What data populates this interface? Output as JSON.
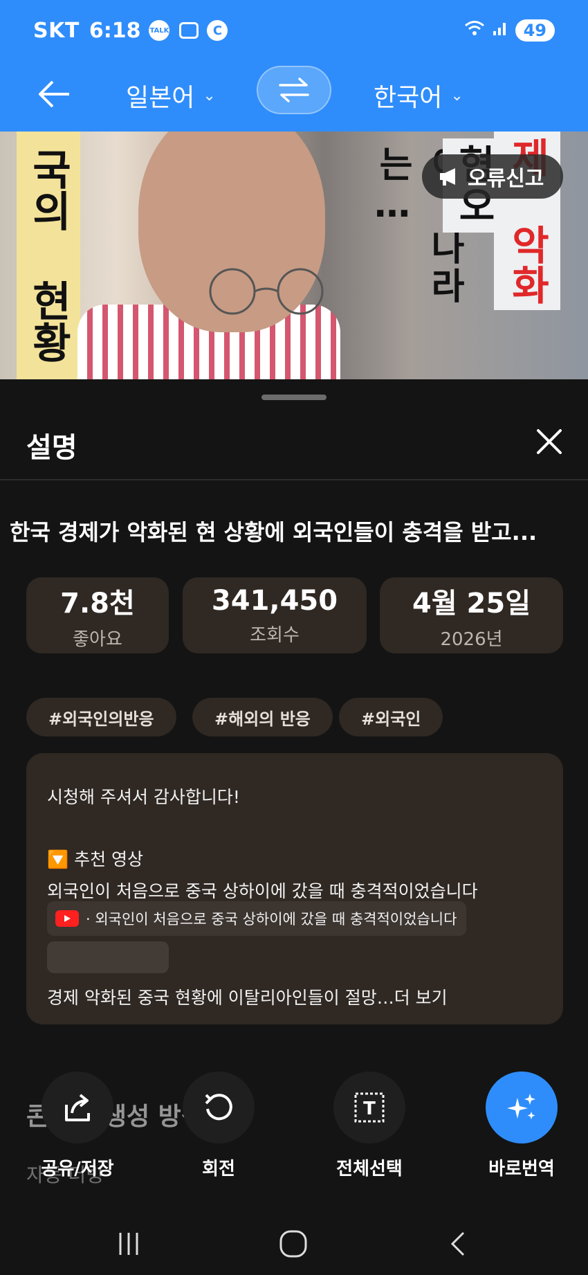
{
  "status_bar": {
    "carrier": "SKT",
    "time": "6:18",
    "talk_icon_label": "TALK",
    "c_icon_label": "C",
    "battery": "49"
  },
  "toolbar": {
    "source_language": "일본어",
    "target_language": "한국어"
  },
  "video": {
    "report_label": "오류신고",
    "overlay_left": "국의 현황",
    "overlay_middle": "이 나라는…",
    "overlay_right": "혐오",
    "overlay_red": "제 악화"
  },
  "sheet": {
    "title": "설명",
    "video_title": "한국 경제가 악화된 현 상황에 외국인들이 충격을 받고...",
    "stats": [
      {
        "value": "7.8천",
        "label": "좋아요"
      },
      {
        "value": "341,450",
        "label": "조회수"
      },
      {
        "value": "4월 25일",
        "label": "2026년"
      }
    ],
    "tags": [
      "#외국인의반응",
      "#해외의 반응",
      "#외국인"
    ],
    "description": {
      "line1": "시청해 주셔서 감사합니다!",
      "recommend_label": "🔽 추천 영상",
      "line3": "외국인이 처음으로 중국 상하이에 갔을 때 충격적이었습니다",
      "chip_text": "· 외국인이 처음으로 중국 상하이에 갔을 때 충격적이었습니다",
      "line5": "경제 악화된 중국 현황에 이탈리아인들이 절망…더 보기"
    },
    "faded_heading": "콘텐츠 생성 방식",
    "faded_sub": "자동 더빙"
  },
  "actions": [
    {
      "label": "공유/저장",
      "icon": "share-icon"
    },
    {
      "label": "회전",
      "icon": "rotate-icon"
    },
    {
      "label": "전체선택",
      "icon": "select-all-icon"
    },
    {
      "label": "바로번역",
      "icon": "sparkle-icon"
    }
  ],
  "colors": {
    "accent": "#2f8dfb",
    "card": "#2f2823",
    "background": "#141414"
  }
}
